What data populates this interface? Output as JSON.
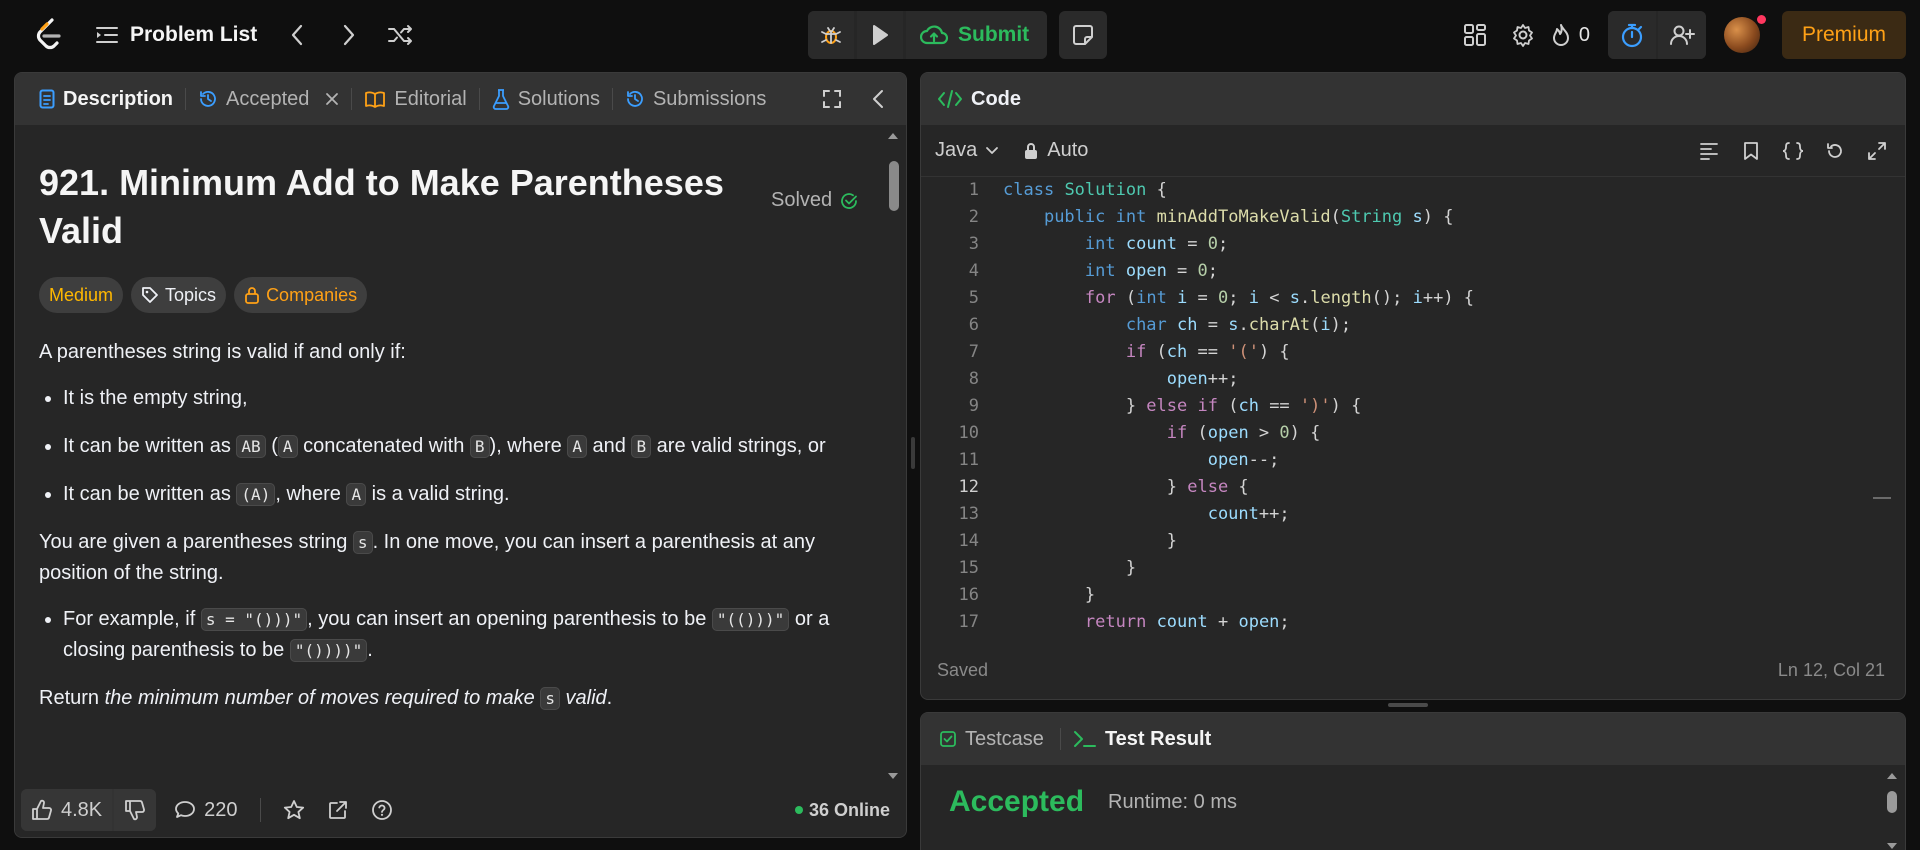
{
  "topbar": {
    "problem_list": "Problem List",
    "submit": "Submit",
    "streak_count": "0",
    "premium": "Premium"
  },
  "left": {
    "tabs": {
      "description": "Description",
      "accepted": "Accepted",
      "editorial": "Editorial",
      "solutions": "Solutions",
      "submissions": "Submissions"
    },
    "title": "921. Minimum Add to Make Parentheses Valid",
    "solved": "Solved",
    "chips": {
      "difficulty": "Medium",
      "topics": "Topics",
      "companies": "Companies"
    },
    "desc": {
      "p1": "A parentheses string is valid if and only if:",
      "li1": "It is the empty string,",
      "li2a": "It can be written as ",
      "li2_ab": "AB",
      "li2b": " (",
      "li2_a": "A",
      "li2c": " concatenated with ",
      "li2_b": "B",
      "li2d": "), where ",
      "li2_a2": "A",
      "li2e": " and ",
      "li2_b2": "B",
      "li2f": " are valid strings, or",
      "li3a": "It can be written as ",
      "li3_code": "(A)",
      "li3b": ", where ",
      "li3_a": "A",
      "li3c": " is a valid string.",
      "p2a": "You are given a parentheses string ",
      "p2_s": "s",
      "p2b": ". In one move, you can insert a parenthesis at any position of the string.",
      "li4a": "For example, if ",
      "li4_c1": "s = \"()))\"",
      "li4b": ", you can insert an opening parenthesis to be ",
      "li4_c2": "\"(()))\"",
      "li4c": " or a closing parenthesis to be ",
      "li4_c3": "\"())))\"",
      "li4d": ".",
      "p3a": "Return ",
      "p3_em": "the minimum number of moves required to make ",
      "p3_s": "s",
      "p3_em2": " valid",
      "p3b": "."
    },
    "footer": {
      "likes": "4.8K",
      "comments": "220",
      "online": "36 Online"
    }
  },
  "code_panel": {
    "title": "Code",
    "language": "Java",
    "auto": "Auto",
    "status": "Saved",
    "cursor": "Ln 12, Col 21",
    "current_line": 12
  },
  "bottom_panel": {
    "testcase": "Testcase",
    "test_result": "Test Result",
    "verdict": "Accepted",
    "runtime": "Runtime: 0 ms"
  },
  "colors": {
    "accent_green": "#2cbb5d",
    "premium_orange": "#ffa116",
    "medium_yellow": "#ffb800",
    "timer_blue": "#3b9eff"
  }
}
